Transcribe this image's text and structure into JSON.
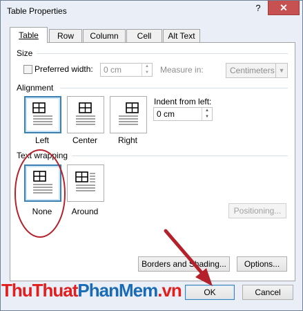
{
  "window": {
    "title": "Table Properties",
    "help_glyph": "?",
    "close_glyph": "✕"
  },
  "tabs": [
    {
      "label": "Table",
      "active": true
    },
    {
      "label": "Row",
      "active": false
    },
    {
      "label": "Column",
      "active": false
    },
    {
      "label": "Cell",
      "active": false
    },
    {
      "label": "Alt Text",
      "active": false
    }
  ],
  "size": {
    "section_label": "Size",
    "preferred_width_label": "Preferred width:",
    "preferred_width_checked": false,
    "preferred_width_value": "0 cm",
    "measure_in_label": "Measure in:",
    "measure_in_value": "Centimeters"
  },
  "alignment": {
    "section_label": "Alignment",
    "options": [
      {
        "label": "Left",
        "selected": true
      },
      {
        "label": "Center",
        "selected": false
      },
      {
        "label": "Right",
        "selected": false
      }
    ],
    "indent_label": "Indent from left:",
    "indent_value": "0 cm"
  },
  "text_wrapping": {
    "section_label": "Text wrapping",
    "options": [
      {
        "label": "None",
        "selected": true
      },
      {
        "label": "Around",
        "selected": false
      }
    ]
  },
  "buttons": {
    "positioning": "Positioning...",
    "borders_shading": "Borders and Shading...",
    "options": "Options...",
    "ok": "OK",
    "cancel": "Cancel"
  },
  "watermark": {
    "part1": "ThuThuat",
    "part2": "PhanMem",
    "part3": ".vn"
  },
  "colors": {
    "accent": "#3c7fb1",
    "annotation_red": "#b5212a",
    "brand_red": "#e11f1f",
    "brand_blue": "#1b6bb4"
  }
}
